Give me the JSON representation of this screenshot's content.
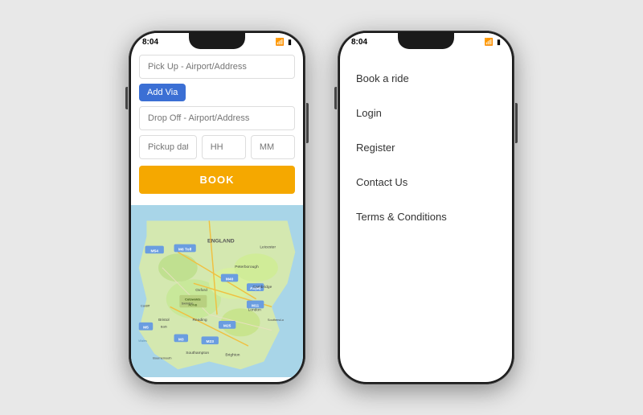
{
  "leftPhone": {
    "statusTime": "8:04",
    "form": {
      "pickupPlaceholder": "Pick Up - Airport/Address",
      "addViaLabel": "Add Via",
      "dropoffPlaceholder": "Drop Off - Airport/Address",
      "datePlaceholder": "Pickup date",
      "hourPlaceholder": "HH",
      "minutePlaceholder": "MM",
      "bookLabel": "BOOK"
    }
  },
  "rightPhone": {
    "statusTime": "8:04",
    "menu": {
      "items": [
        {
          "label": "Book a ride"
        },
        {
          "label": "Login"
        },
        {
          "label": "Register"
        },
        {
          "label": "Contact Us"
        },
        {
          "label": "Terms & Conditions"
        }
      ]
    }
  },
  "colors": {
    "addVia": "#3b6fd4",
    "book": "#f5a800"
  }
}
